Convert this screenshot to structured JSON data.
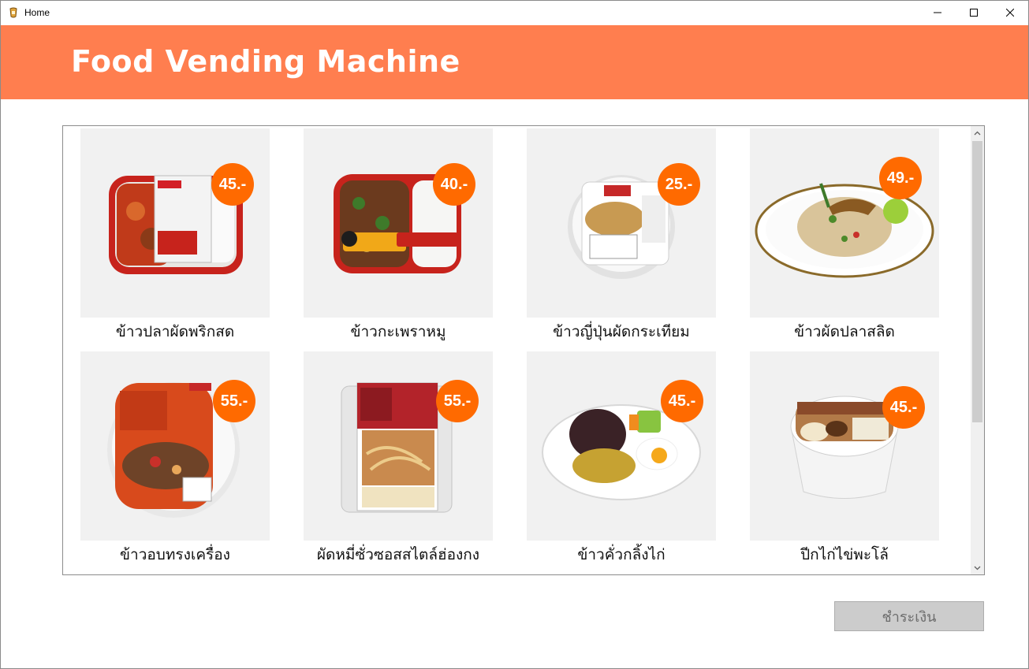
{
  "window": {
    "title": "Home"
  },
  "header": {
    "title": "Food Vending Machine"
  },
  "menu": {
    "items": [
      {
        "name": "ข้าวปลาผัดพริกสด",
        "price": "45.-",
        "dish": "red-curry-fish-tray"
      },
      {
        "name": "ข้าวกะเพราหมู",
        "price": "40.-",
        "dish": "basil-pork-tray"
      },
      {
        "name": "ข้าวญี่ปุ่นผัดกระเทียม",
        "price": "25.-",
        "dish": "garlic-rice-bowl"
      },
      {
        "name": "ข้าวผัดปลาสลิด",
        "price": "49.-",
        "dish": "fried-rice-plate"
      },
      {
        "name": "ข้าวอบทรงเครื่อง",
        "price": "55.-",
        "dish": "baked-rice-bowl"
      },
      {
        "name": "ผัดหมี่ซั่วซอสสไตล์ฮ่องกง",
        "price": "55.-",
        "dish": "noodle-box"
      },
      {
        "name": "ข้าวคั่วกลิ้งไก่",
        "price": "45.-",
        "dish": "chicken-rice-plate"
      },
      {
        "name": "ปีกไก่ไข่พะโล้",
        "price": "45.-",
        "dish": "stew-bowl"
      }
    ]
  },
  "footer": {
    "pay_label": "ชำระเงิน"
  },
  "colors": {
    "header": "#ff7e4f",
    "badge": "#ff6a00",
    "card_bg": "#f1f1f1"
  }
}
